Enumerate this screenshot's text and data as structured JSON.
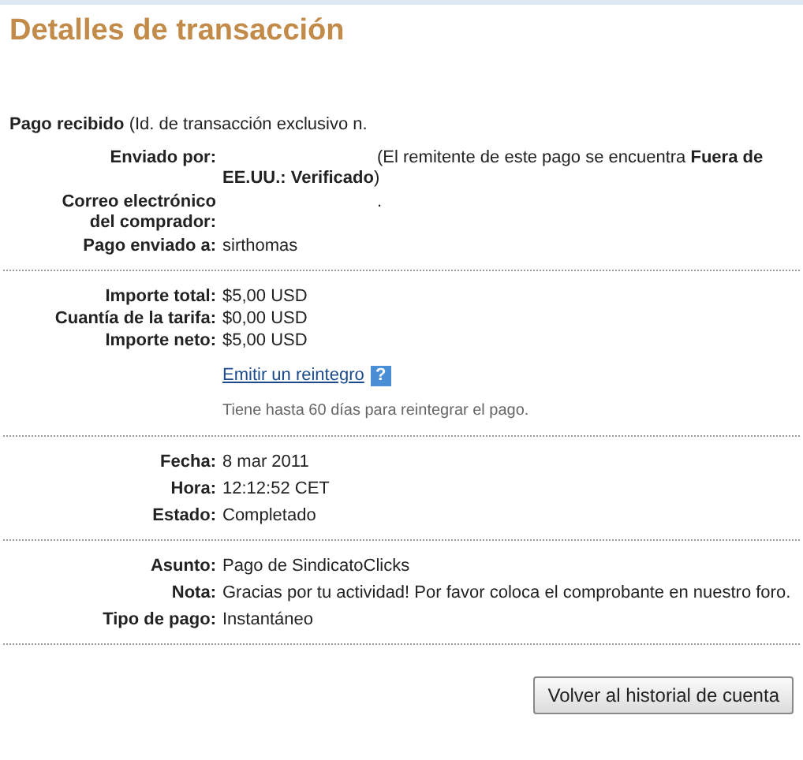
{
  "title": "Detalles de transacción",
  "heading": {
    "bold": "Pago recibido",
    "text": "(Id. de transacción exclusivo n."
  },
  "sections": [
    {
      "rows": [
        {
          "label": "Enviado por:",
          "value": "(El remitente de este pago se encuentra **Fuera de EE.UU.: Verificado**)",
          "kind": "indented"
        },
        {
          "label": "Correo electrónico del comprador:",
          "value": ".",
          "kind": "indented"
        },
        {
          "label": "Pago enviado a:",
          "value": "sirthomas",
          "kind": "plain"
        }
      ]
    },
    {
      "rows": [
        {
          "label": "Importe total:",
          "value": "$5,00 USD",
          "kind": "plain"
        },
        {
          "label": "Cuantía de la tarifa:",
          "value": "$0,00 USD",
          "kind": "plain"
        },
        {
          "label": "Importe neto:",
          "value": "$5,00 USD",
          "kind": "plain"
        }
      ],
      "refund": {
        "link": "Emitir un reintegro",
        "help": "?",
        "note": "Tiene hasta 60 días para reintegrar el pago."
      }
    },
    {
      "rows": [
        {
          "label": "Fecha:",
          "value": "8 mar 2011",
          "kind": "plain"
        },
        {
          "label": "Hora:",
          "value": "12:12:52 CET",
          "kind": "plain"
        },
        {
          "label": "Estado:",
          "value": "Completado",
          "kind": "plain"
        }
      ]
    },
    {
      "rows": [
        {
          "label": "Asunto:",
          "value": "Pago de SindicatoClicks",
          "kind": "plain"
        },
        {
          "label": "Nota:",
          "value": "Gracias por tu actividad! Por favor coloca el comprobante en nuestro foro.",
          "kind": "plain"
        },
        {
          "label": "Tipo de pago:",
          "value": "Instantáneo",
          "kind": "plain"
        }
      ]
    }
  ],
  "button": "Volver al historial de cuenta"
}
